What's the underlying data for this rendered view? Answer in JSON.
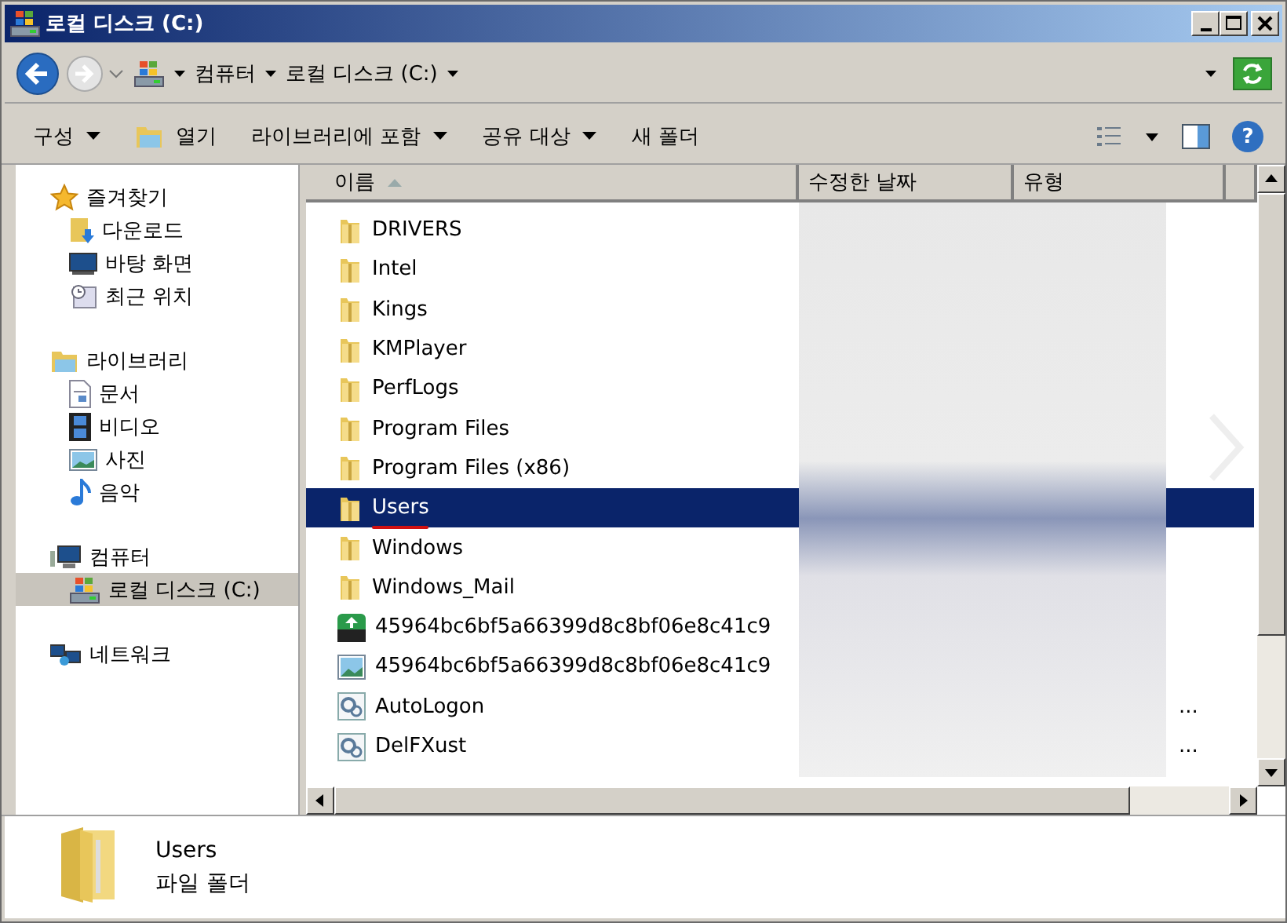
{
  "window": {
    "title": "로컬 디스크 (C:)"
  },
  "address": {
    "crumbs": [
      "컴퓨터",
      "로컬 디스크 (C:)"
    ]
  },
  "toolbar": {
    "help": "?",
    "items": [
      {
        "label": "구성",
        "kind": "menu"
      },
      {
        "label": "열기",
        "kind": "open"
      },
      {
        "label": "라이브러리에 포함",
        "kind": "menu"
      },
      {
        "label": "공유 대상",
        "kind": "menu"
      },
      {
        "label": "새 폴더",
        "kind": "plain"
      }
    ]
  },
  "sidebar": {
    "groups": [
      {
        "label": "즐겨찾기",
        "children": [
          {
            "label": "다운로드",
            "selected": false
          },
          {
            "label": "바탕 화면",
            "selected": false
          },
          {
            "label": "최근 위치",
            "selected": false
          }
        ]
      },
      {
        "label": "라이브러리",
        "children": [
          {
            "label": "문서",
            "selected": false
          },
          {
            "label": "비디오",
            "selected": false
          },
          {
            "label": "사진",
            "selected": false
          },
          {
            "label": "음악",
            "selected": false
          }
        ]
      },
      {
        "label": "컴퓨터",
        "children": [
          {
            "label": "로컬 디스크 (C:)",
            "selected": true
          }
        ]
      },
      {
        "label": "네트워크"
      }
    ]
  },
  "table": {
    "columns": [
      {
        "label": "이름",
        "sorted": true
      },
      {
        "label": "수정한 날짜",
        "sorted": false
      },
      {
        "label": "유형",
        "sorted": false
      }
    ],
    "rows": [
      {
        "name": "DRIVERS",
        "kind": "folder",
        "selected": false,
        "underlined": false
      },
      {
        "name": "Intel",
        "kind": "folder",
        "selected": false,
        "underlined": false
      },
      {
        "name": "Kings",
        "kind": "folder",
        "selected": false,
        "underlined": false
      },
      {
        "name": "KMPlayer",
        "kind": "folder",
        "selected": false,
        "underlined": false
      },
      {
        "name": "PerfLogs",
        "kind": "folder",
        "selected": false,
        "underlined": false
      },
      {
        "name": "Program Files",
        "kind": "folder",
        "selected": false,
        "underlined": false
      },
      {
        "name": "Program Files (x86)",
        "kind": "folder",
        "selected": false,
        "underlined": false
      },
      {
        "name": "Users",
        "kind": "folder",
        "selected": true,
        "underlined": true
      },
      {
        "name": "Windows",
        "kind": "folder",
        "selected": false,
        "underlined": false
      },
      {
        "name": "Windows_Mail",
        "kind": "folder",
        "selected": false,
        "underlined": false
      },
      {
        "name": "45964bc6bf5a66399d8c8bf06e8c41c9",
        "kind": "installer",
        "selected": false,
        "underlined": false
      },
      {
        "name": "45964bc6bf5a66399d8c8bf06e8c41c9",
        "kind": "image",
        "selected": false,
        "underlined": false
      },
      {
        "name": "AutoLogon",
        "kind": "settings",
        "selected": false,
        "underlined": false,
        "column_4": "..."
      },
      {
        "name": "DelFXust",
        "kind": "settings",
        "selected": false,
        "underlined": false,
        "column_4": "..."
      }
    ]
  },
  "details": {
    "name": "Users",
    "type": "파일 폴더"
  }
}
